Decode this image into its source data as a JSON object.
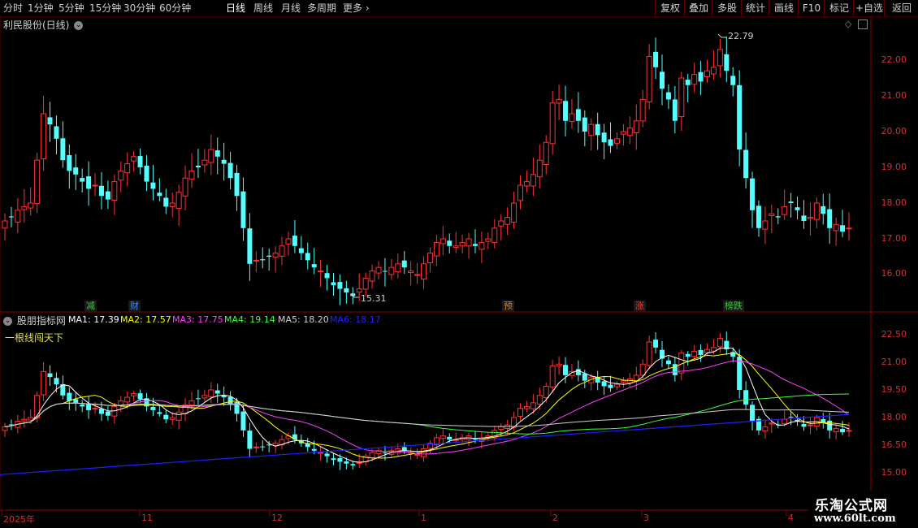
{
  "toolbar": {
    "periods": [
      "分时",
      "1分钟",
      "5分钟",
      "15分钟",
      "30分钟",
      "60分钟",
      "日线",
      "周线",
      "月线",
      "多周期"
    ],
    "more": "更多",
    "active": "日线",
    "right_buttons": [
      "复权",
      "叠加",
      "多股",
      "统计",
      "画线",
      "F10",
      "标记",
      "+自选",
      "返回"
    ]
  },
  "main_panel": {
    "title": "利民股份(日线)",
    "high_label": "22.79",
    "low_label": "15.31",
    "y_ticks": [
      "22.00",
      "21.00",
      "20.00",
      "19.00",
      "18.00",
      "17.00",
      "16.00"
    ],
    "markers": [
      {
        "text": "减",
        "color": "#40c040"
      },
      {
        "text": "财",
        "color": "#4080ff"
      },
      {
        "text": "预",
        "color": "#e08020"
      },
      {
        "text": "涨",
        "color": "#ff3030"
      },
      {
        "text": "榜跌",
        "color": "#40c040"
      }
    ]
  },
  "indicator_panel": {
    "title": "股朋指标网",
    "subtitle": "一根线闯天下",
    "ma_values": [
      {
        "label": "MA1: 17.39",
        "color": "#ffffff"
      },
      {
        "label": "MA2: 17.57",
        "color": "#ffff00"
      },
      {
        "label": "MA3: 17.75",
        "color": "#ff40ff"
      },
      {
        "label": "MA4: 19.14",
        "color": "#40ff40"
      },
      {
        "label": "MA5: 18.20",
        "color": "#d0d0d0"
      },
      {
        "label": "MA6: 18.17",
        "color": "#2020ff"
      }
    ],
    "y_ticks": [
      "22.50",
      "21.00",
      "19.50",
      "18.00",
      "16.50",
      "15.00"
    ]
  },
  "date_axis": [
    "2025年",
    "11",
    "12",
    "1",
    "2",
    "3",
    "4"
  ],
  "watermark": {
    "line1": "乐淘公式网",
    "line2": "www.60lt.com"
  },
  "chart_data": {
    "type": "candlestick",
    "title": "利民股份(日线)",
    "ylim_main": [
      15.2,
      22.9
    ],
    "high": 22.79,
    "low": 15.31,
    "closes": [
      17.5,
      17.6,
      17.8,
      17.9,
      18.0,
      19.2,
      20.5,
      20.2,
      19.8,
      19.2,
      18.9,
      18.8,
      18.6,
      18.4,
      18.5,
      18.2,
      18.1,
      18.6,
      18.9,
      19.1,
      19.3,
      19.0,
      18.6,
      18.4,
      18.2,
      17.9,
      18.0,
      18.3,
      18.7,
      18.9,
      19.0,
      19.2,
      19.5,
      19.3,
      19.1,
      18.7,
      18.2,
      17.3,
      16.3,
      16.4,
      16.4,
      16.5,
      16.6,
      16.8,
      17.0,
      16.8,
      16.6,
      16.4,
      16.2,
      16.1,
      15.9,
      15.7,
      15.6,
      15.5,
      15.4,
      15.6,
      15.9,
      16.1,
      16.2,
      16.1,
      16.2,
      16.3,
      16.2,
      16.1,
      16.0,
      16.3,
      16.6,
      16.9,
      17.0,
      16.8,
      16.8,
      16.9,
      17.0,
      16.8,
      16.9,
      17.0,
      17.3,
      17.5,
      17.6,
      18.0,
      18.5,
      18.6,
      18.8,
      19.2,
      19.7,
      20.8,
      20.9,
      20.3,
      20.5,
      20.3,
      20.0,
      20.2,
      19.9,
      19.7,
      19.6,
      19.8,
      20.0,
      20.1,
      20.3,
      20.9,
      22.1,
      21.8,
      21.2,
      20.9,
      20.3,
      21.5,
      21.3,
      21.6,
      21.4,
      21.7,
      21.8,
      22.3,
      21.7,
      21.3,
      19.5,
      18.7,
      17.8,
      17.3,
      17.5,
      17.7,
      17.6,
      17.9,
      18.0,
      17.8,
      17.5,
      17.6,
      18.0,
      17.7,
      17.3,
      17.4,
      17.2,
      17.3
    ]
  }
}
